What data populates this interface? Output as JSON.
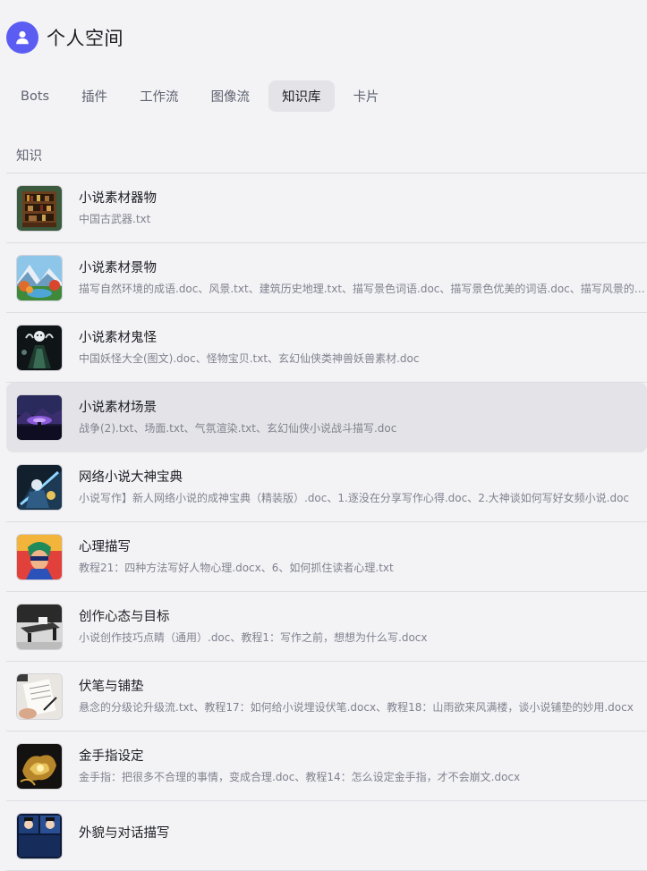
{
  "header": {
    "title": "个人空间"
  },
  "tabs": [
    {
      "label": "Bots",
      "active": false
    },
    {
      "label": "插件",
      "active": false
    },
    {
      "label": "工作流",
      "active": false
    },
    {
      "label": "图像流",
      "active": false
    },
    {
      "label": "知识库",
      "active": true
    },
    {
      "label": "卡片",
      "active": false
    }
  ],
  "section": {
    "label": "知识"
  },
  "knowledge_items": [
    {
      "name": "小说素材器物",
      "files": "中国古武器.txt",
      "thumbnail": "bookshelf-image"
    },
    {
      "name": "小说素材景物",
      "files": "描写自然环境的成语.doc、风景.txt、建筑历史地理.txt、描写景色词语.doc、描写景色优美的词语.doc、描写风景的词语.doc",
      "thumbnail": "landscape-image"
    },
    {
      "name": "小说素材鬼怪",
      "files": "中国妖怪大全(图文).doc、怪物宝贝.txt、玄幻仙侠类神兽妖兽素材.doc",
      "thumbnail": "ghost-image"
    },
    {
      "name": "小说素材场景",
      "files": "战争(2).txt、场面.txt、气氛渲染.txt、玄幻仙侠小说战斗描写.doc",
      "thumbnail": "scene-image"
    },
    {
      "name": "网络小说大神宝典",
      "files": "小说写作】新人网络小说的成神宝典（精装版）.doc、1.逐没在分享写作心得.doc、2.大神谈如何写好女频小说.doc",
      "thumbnail": "warrior-image"
    },
    {
      "name": "心理描写",
      "files": "教程21：四种方法写好人物心理.docx、6、如何抓住读者心理.txt",
      "thumbnail": "hero-image"
    },
    {
      "name": "创作心态与目标",
      "files": "小说创作技巧点睛（通用）.doc、教程1：写作之前，想想为什么写.docx",
      "thumbnail": "desk-image"
    },
    {
      "name": "伏笔与铺垫",
      "files": "悬念的分级论升级流.txt、教程17：如何给小说埋设伏笔.docx、教程18：山雨欲来风满楼，谈小说铺垫的妙用.docx",
      "thumbnail": "writing-image"
    },
    {
      "name": "金手指设定",
      "files": "金手指：把很多不合理的事情，变成合理.doc、教程14：怎么设定金手指，才不会崩文.docx",
      "thumbnail": "golden-image"
    },
    {
      "name": "外貌与对话描写",
      "files": "",
      "thumbnail": "comic-image"
    }
  ],
  "colors": {
    "background": "#f3f3f6",
    "avatar": "#5b5df2",
    "active_tab": "#e4e4e8",
    "text_primary": "#1c1d23",
    "text_secondary": "#80828e"
  },
  "icons": {
    "avatar": "user-icon"
  }
}
